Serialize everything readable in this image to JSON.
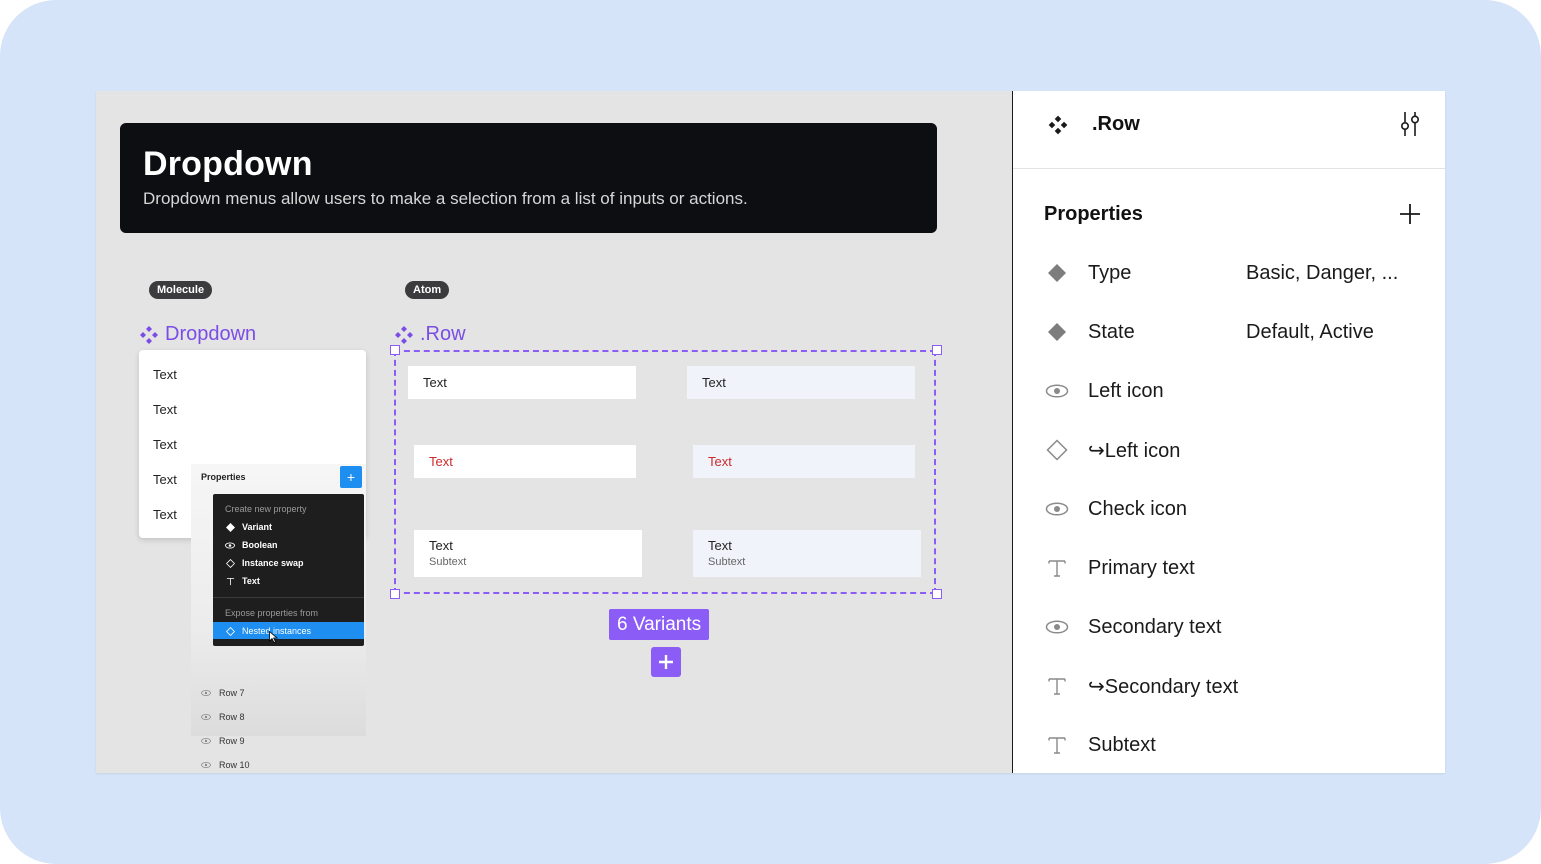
{
  "canvas": {
    "banner": {
      "title": "Dropdown",
      "description": "Dropdown menus allow users to make a selection from a list of inputs or actions."
    },
    "molecule_label": "Molecule",
    "atom_label": "Atom",
    "dropdown_title": "Dropdown",
    "row_title": ".Row",
    "dropdown_items": [
      "Text",
      "Text",
      "Text",
      "Text",
      "Text"
    ],
    "mini_panel": {
      "title": "Properties",
      "plus": "+",
      "rows": [
        "Row 7",
        "Row 8",
        "Row 9",
        "Row 10"
      ]
    },
    "popup": {
      "create_header": "Create new property",
      "options": [
        "Variant",
        "Boolean",
        "Instance swap",
        "Text"
      ],
      "expose_header": "Expose properties from",
      "selected_option": "Nested instances"
    },
    "variants": [
      {
        "text": "Text",
        "subtext": ""
      },
      {
        "text": "Text",
        "subtext": ""
      },
      {
        "text": "Text",
        "subtext": ""
      },
      {
        "text": "Text",
        "subtext": ""
      },
      {
        "text": "Text",
        "subtext": "Subtext"
      },
      {
        "text": "Text",
        "subtext": "Subtext"
      }
    ],
    "variants_badge": "6 Variants"
  },
  "panel": {
    "component_name": ".Row",
    "section_title": "Properties",
    "properties": [
      {
        "icon": "variant-diamond-icon",
        "name": "Type",
        "value": "Basic, Danger, ..."
      },
      {
        "icon": "variant-diamond-icon",
        "name": "State",
        "value": "Default, Active"
      },
      {
        "icon": "eye-icon",
        "name": "Left icon",
        "value": ""
      },
      {
        "icon": "instance-swap-icon",
        "name": "↪Left icon",
        "value": ""
      },
      {
        "icon": "eye-icon",
        "name": "Check icon",
        "value": ""
      },
      {
        "icon": "text-icon",
        "name": "Primary text",
        "value": ""
      },
      {
        "icon": "eye-icon",
        "name": "Secondary text",
        "value": ""
      },
      {
        "icon": "text-icon",
        "name": "↪Secondary text",
        "value": ""
      },
      {
        "icon": "text-icon",
        "name": "Subtext",
        "value": ""
      }
    ]
  },
  "colors": {
    "accent": "#8b5cf6",
    "selection_blue": "#1e8ef0",
    "danger": "#cc2a2a",
    "background": "#d5e4f9"
  }
}
